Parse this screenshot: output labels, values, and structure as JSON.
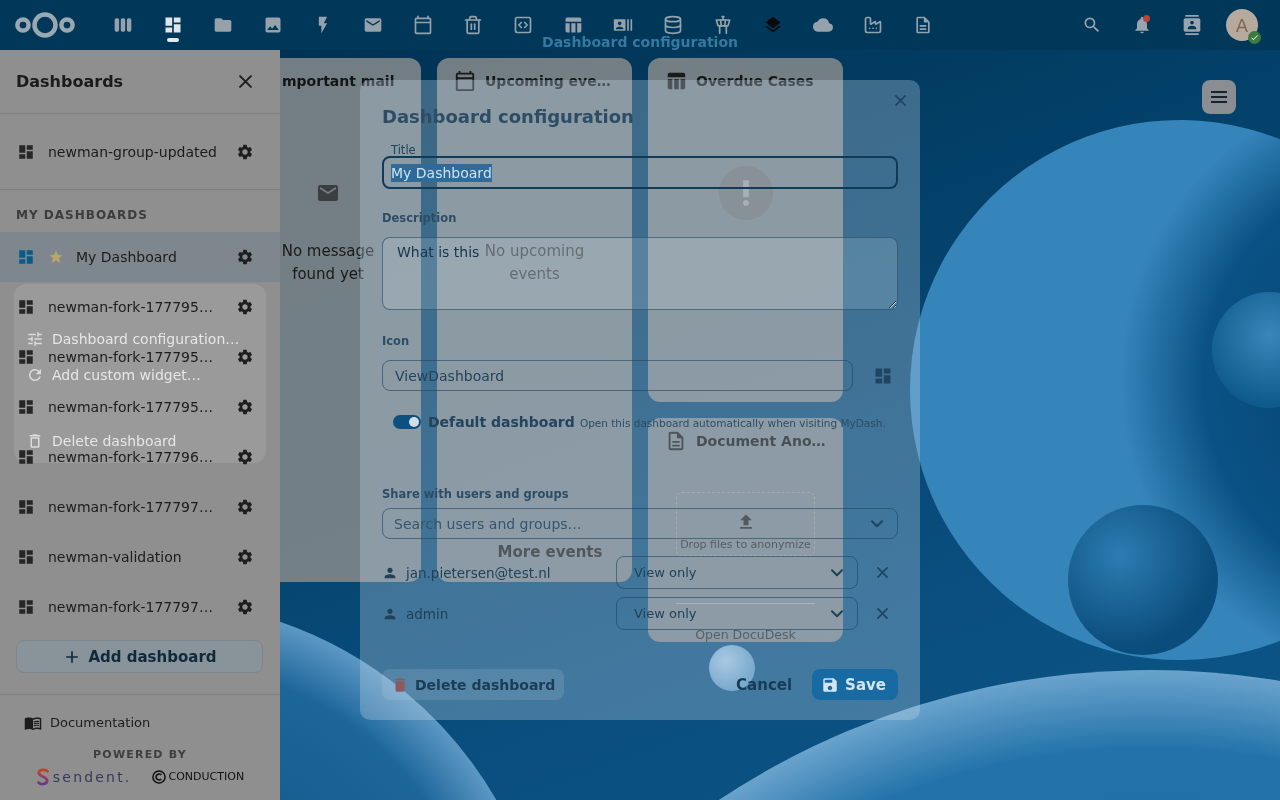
{
  "header": {
    "title": "Dashboard configuration",
    "apps": [
      {
        "selected": false
      },
      {
        "selected": true
      },
      {
        "selected": false
      },
      {
        "selected": false
      },
      {
        "selected": false
      },
      {
        "selected": false
      },
      {
        "selected": false
      },
      {
        "selected": false
      },
      {
        "selected": false
      },
      {
        "selected": false
      },
      {
        "selected": false
      },
      {
        "selected": false
      },
      {
        "selected": false
      },
      {
        "selected": false
      },
      {
        "selected": false
      },
      {
        "selected": false
      },
      {
        "selected": false
      }
    ],
    "notifications_unread": true,
    "avatar": {
      "initial": "A",
      "online": true
    }
  },
  "sidebar": {
    "title": "Dashboards",
    "group_dashboards": [
      {
        "name": "newman-group-updated",
        "selected": false
      }
    ],
    "section_label": "MY DASHBOARDS",
    "dashboards": [
      {
        "name": "My Dashboard",
        "selected": true,
        "default": true
      },
      {
        "name": "newman-fork-177795…",
        "selected": false,
        "default": false
      },
      {
        "name": "newman-fork-177795…",
        "selected": false,
        "default": false
      },
      {
        "name": "newman-fork-177795…",
        "selected": false,
        "default": false
      },
      {
        "name": "newman-fork-177796…",
        "selected": false,
        "default": false
      },
      {
        "name": "newman-fork-177797…",
        "selected": false,
        "default": false
      },
      {
        "name": "newman-validation",
        "selected": false,
        "default": false
      },
      {
        "name": "newman-fork-177797…",
        "selected": false,
        "default": false
      }
    ],
    "menu": [
      {
        "label": "Dashboard configuration…"
      },
      {
        "label": "Add custom widget…"
      },
      {
        "label": "Delete dashboard"
      }
    ],
    "add_button": "Add dashboard",
    "documentation": "Documentation",
    "powered_by": "POWERED BY",
    "partners": [
      "sendent.",
      "CONDUCTION"
    ]
  },
  "widgets": [
    {
      "title": "mportant mail",
      "kind": "empty",
      "message": "No message found yet"
    },
    {
      "title": "Upcoming eve…",
      "kind": "empty",
      "message": "No upcoming events",
      "footer": "More events"
    },
    {
      "title": "Overdue Cases",
      "kind": "error"
    },
    {
      "title": "Document Ano…",
      "kind": "dropzone",
      "message": "Drop files to anonymize",
      "footer": "Open DocuDesk"
    }
  ],
  "modal": {
    "title": "Dashboard configuration",
    "title_field": {
      "label": "Title",
      "value": "My Dashboard",
      "text_selected": true
    },
    "description": {
      "label": "Description",
      "placeholder": "What is this"
    },
    "icon_field": {
      "label": "Icon",
      "value": "ViewDashboard"
    },
    "default_toggle": {
      "label": "Default dashboard",
      "hint": "Open this dashboard automatically when visiting MyDash.",
      "on": true
    },
    "share": {
      "label": "Share with users and groups",
      "placeholder": "Search users and groups…",
      "entries": [
        {
          "name": "jan.pietersen@test.nl",
          "permission": "View only"
        },
        {
          "name": "admin",
          "permission": "View only"
        }
      ]
    },
    "buttons": {
      "delete": "Delete dashboard",
      "cancel": "Cancel",
      "save": "Save"
    }
  }
}
